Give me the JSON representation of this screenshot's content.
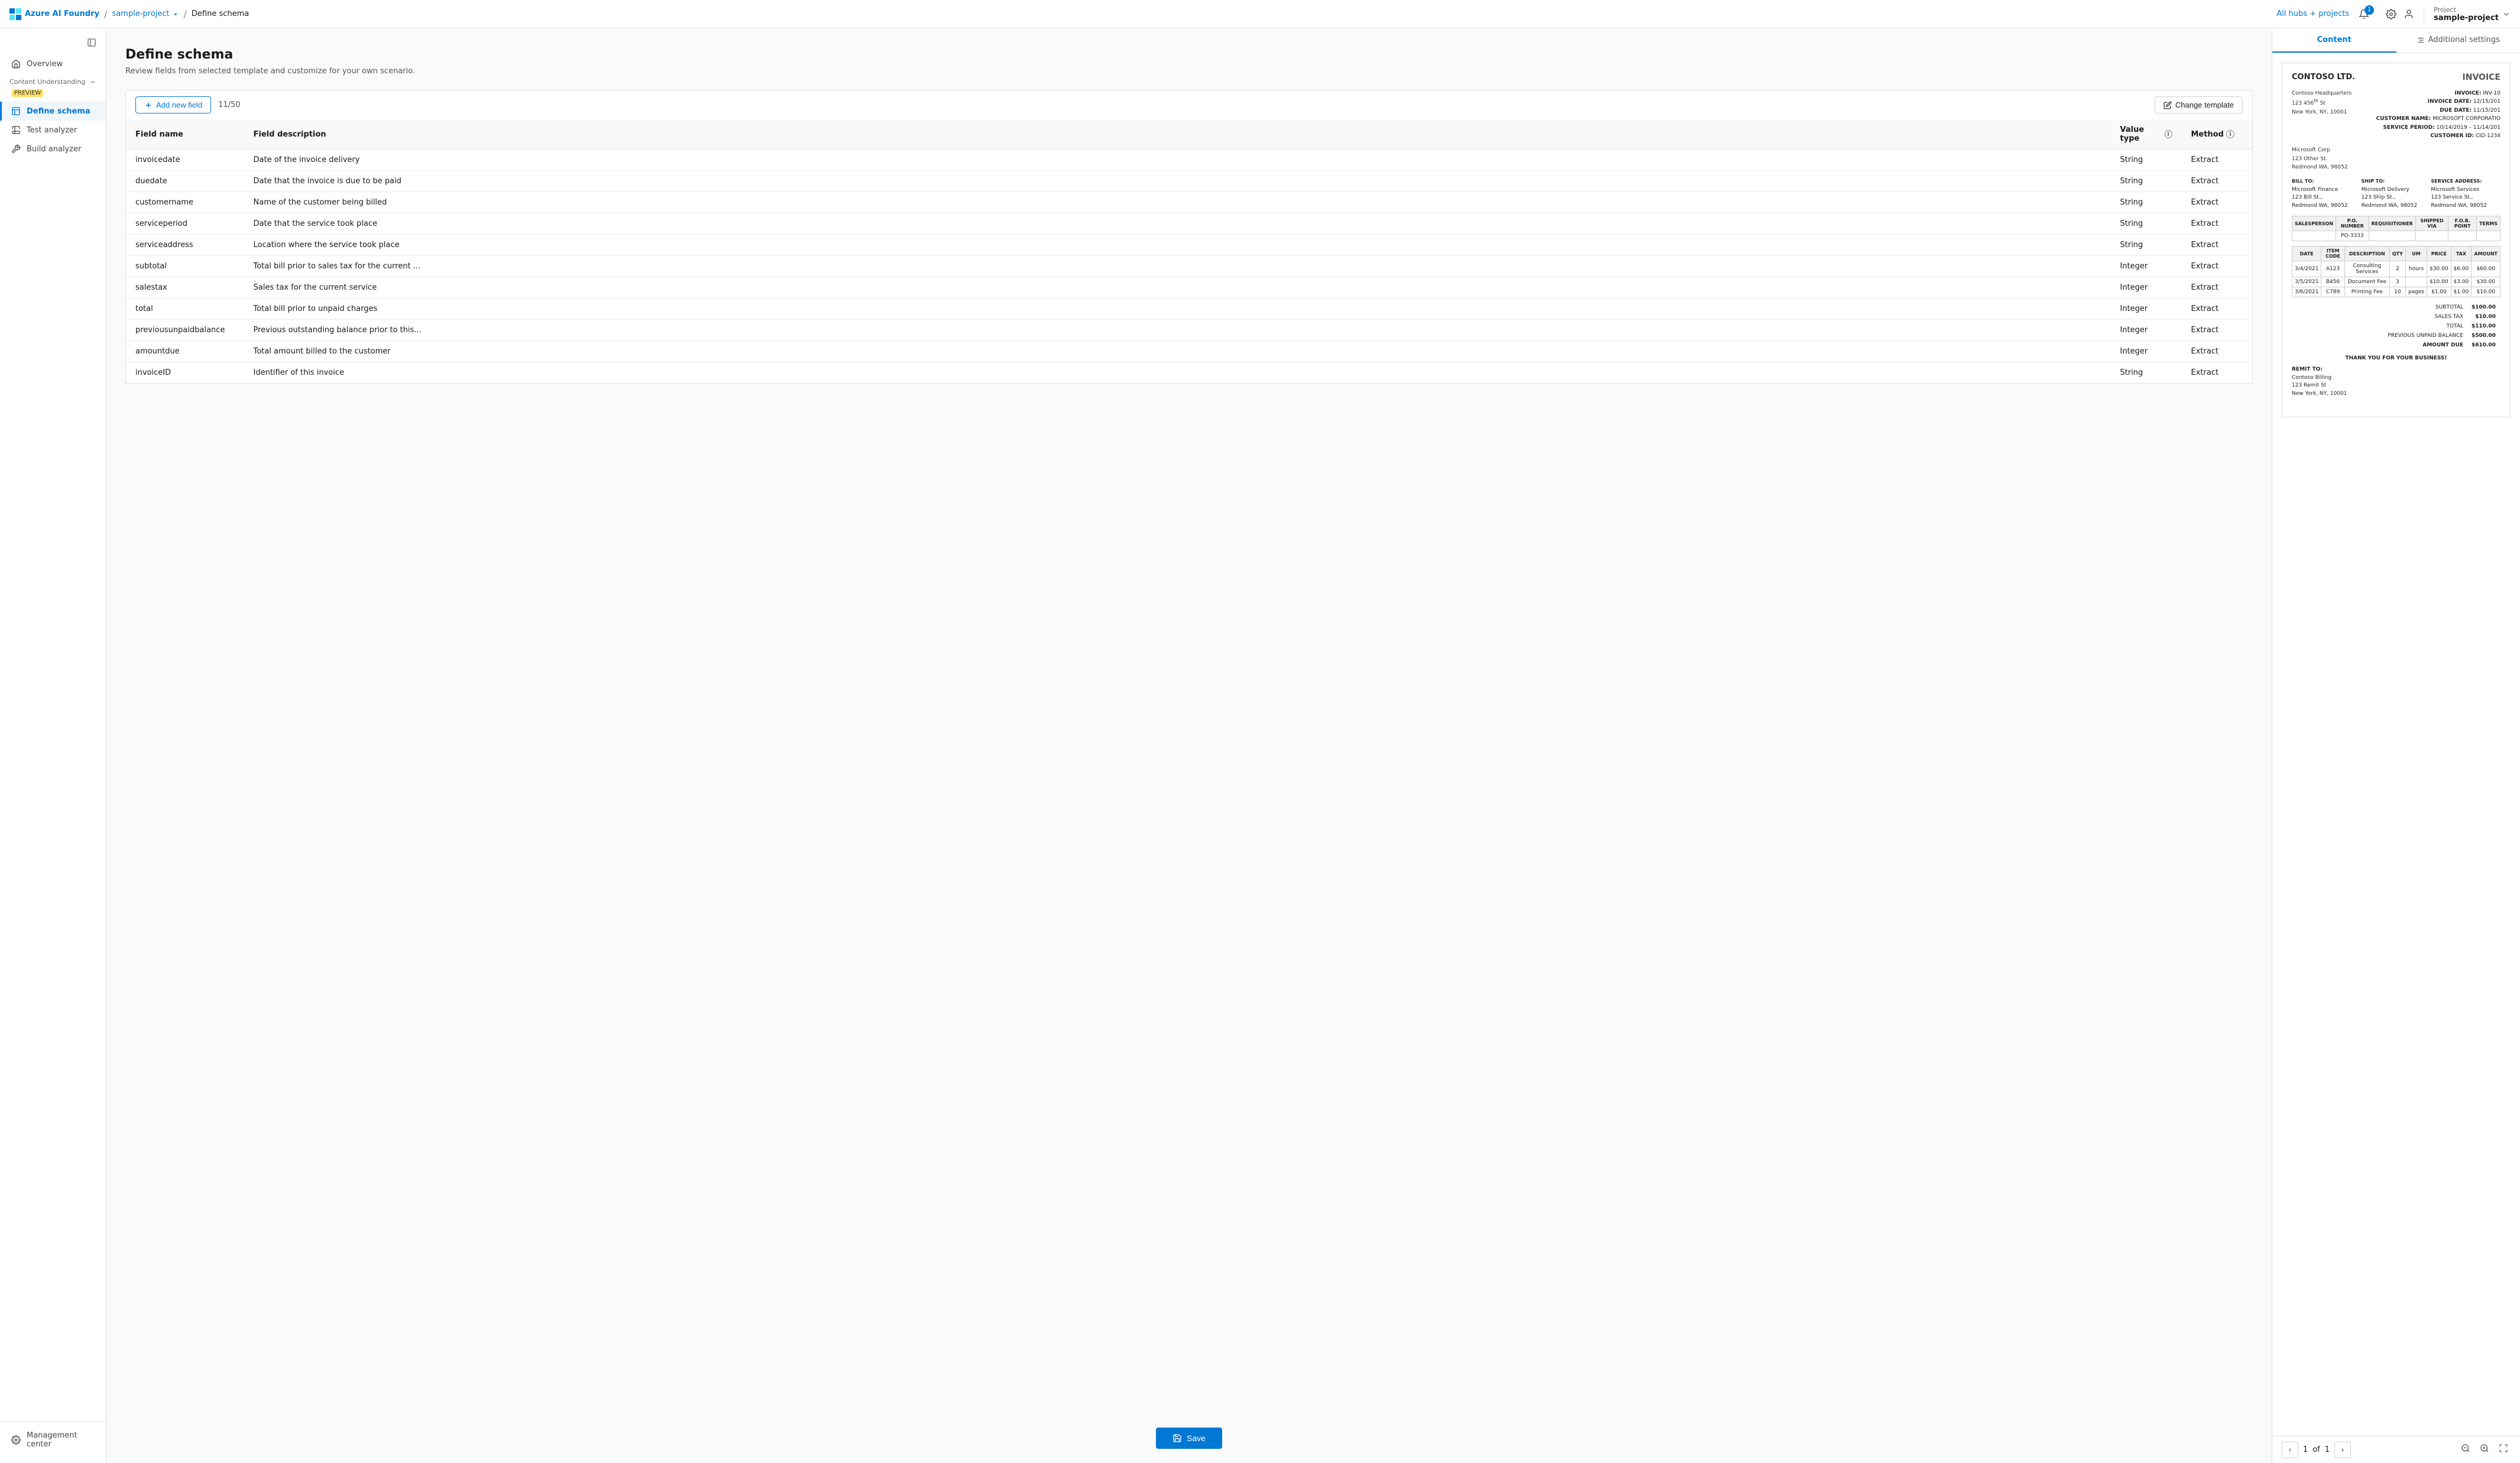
{
  "app": {
    "brand": "Azure AI Foundry",
    "project": "sample-project",
    "page": "Define schema",
    "hubs_link": "All hubs + projects",
    "project_label": "Project",
    "project_name": "sample-project"
  },
  "sidebar": {
    "toggle_title": "Collapse sidebar",
    "section_label": "Content Understanding",
    "section_badge": "PREVIEW",
    "items": [
      {
        "id": "overview",
        "label": "Overview",
        "icon": "home"
      },
      {
        "id": "define-schema",
        "label": "Define schema",
        "icon": "schema",
        "active": true
      },
      {
        "id": "test-analyzer",
        "label": "Test analyzer",
        "icon": "test"
      },
      {
        "id": "build-analyzer",
        "label": "Build analyzer",
        "icon": "build"
      }
    ],
    "bottom_item": {
      "id": "management",
      "label": "Management center",
      "icon": "settings"
    }
  },
  "schema": {
    "title": "Define schema",
    "subtitle": "Review fields from selected template and customize for your own scenario.",
    "toolbar": {
      "add_button": "Add new field",
      "field_count": "11/50",
      "change_template_button": "Change template"
    },
    "table": {
      "headers": [
        "Field name",
        "Field description",
        "Value type",
        "Method"
      ],
      "rows": [
        {
          "name": "invoicedate",
          "description": "Date of the invoice delivery",
          "type": "String",
          "method": "Extract"
        },
        {
          "name": "duedate",
          "description": "Date that the invoice is due to be paid",
          "type": "String",
          "method": "Extract"
        },
        {
          "name": "customername",
          "description": "Name of the customer being billed",
          "type": "String",
          "method": "Extract"
        },
        {
          "name": "serviceperiod",
          "description": "Date that the service took place",
          "type": "String",
          "method": "Extract"
        },
        {
          "name": "serviceaddress",
          "description": "Location where the service took place",
          "type": "String",
          "method": "Extract"
        },
        {
          "name": "subtotal",
          "description": "Total bill prior to sales tax for the current ...",
          "type": "Integer",
          "method": "Extract"
        },
        {
          "name": "salestax",
          "description": "Sales tax for the current service",
          "type": "Integer",
          "method": "Extract"
        },
        {
          "name": "total",
          "description": "Total bill prior to unpaid charges",
          "type": "Integer",
          "method": "Extract"
        },
        {
          "name": "previousunpaidbalance",
          "description": "Previous outstanding balance prior to this...",
          "type": "Integer",
          "method": "Extract"
        },
        {
          "name": "amountdue",
          "description": "Total amount billed to the customer",
          "type": "Integer",
          "method": "Extract"
        },
        {
          "name": "invoiceID",
          "description": "Identifier of this invoice",
          "type": "String",
          "method": "Extract"
        }
      ]
    },
    "save_button": "Save"
  },
  "right_panel": {
    "tabs": [
      {
        "id": "content",
        "label": "Content",
        "active": true
      },
      {
        "id": "additional-settings",
        "label": "Additional settings"
      }
    ],
    "invoice": {
      "company": "CONTOSO LTD.",
      "invoice_title": "INVOICE",
      "address_block": "Contoso Headquarters\n123 456th St\nNew York, NY, 10001",
      "meta_lines": [
        "INVOICE: INV-10",
        "INVOICE DATE: 12/15/201",
        "DUE DATE: 11/15/201",
        "CUSTOMER NAME: MICROSOFT CORPORATIO",
        "SERVICE PERIOD: 10/14/2019 - 11/14/201",
        "CUSTOMER ID: CID-1234"
      ],
      "ship_from": "Microsoft Corp\n123 Other St.\nRedmond WA, 98052",
      "bill_to_label": "BILL TO:",
      "bill_to": "Microsoft Finance\n123 Bill St.,\nRedmond WA, 98052",
      "ship_to_label": "SHIP TO:",
      "ship_to": "Microsoft Delivery\n123 Ship St.,\nRedmond WA, 98052",
      "service_address_label": "SERVICE ADDRESS:",
      "service_address": "Microsoft Services\n123 Service St.,\nRedmond WA, 98052",
      "order_headers": [
        "SALESPERSON",
        "P.O. NUMBER",
        "REQUISITIONER",
        "SHIPPED VIA",
        "F.O.B. POINT",
        "TERMS"
      ],
      "order_row": [
        "",
        "PO-3333",
        "",
        "",
        "",
        ""
      ],
      "line_headers": [
        "DATE",
        "ITEM CODE",
        "DESCRIPTION",
        "QTY",
        "UM",
        "PRICE",
        "TAX",
        "AMOUNT"
      ],
      "line_items": [
        {
          "date": "3/4/2021",
          "code": "A123",
          "desc": "Consulting Services",
          "qty": "2",
          "um": "hours",
          "price": "$30.00",
          "tax": "$6.00",
          "amount": "$60.00"
        },
        {
          "date": "3/5/2021",
          "code": "B456",
          "desc": "Document Fee",
          "qty": "3",
          "um": "",
          "price": "$10.00",
          "tax": "$3.00",
          "amount": "$30.00"
        },
        {
          "date": "3/6/2021",
          "code": "C789",
          "desc": "Printing Fee",
          "qty": "10",
          "um": "pages",
          "price": "$1.00",
          "tax": "$1.00",
          "amount": "$10.00"
        }
      ],
      "subtotal_label": "SUBTOTAL",
      "subtotal_value": "$100.00",
      "salestax_label": "SALES TAX",
      "salestax_value": "$10.00",
      "total_label": "TOTAL",
      "total_value": "$110.00",
      "prev_label": "PREVIOUS UNPAID BALANCE",
      "prev_value": "$500.00",
      "amount_label": "AMOUNT DUE",
      "amount_value": "$610.00",
      "thank_you": "THANK YOU FOR YOUR BUSINESS!",
      "remit_label": "REMIT TO:",
      "remit": "Contoso Billing\n123 Remit St\nNew York, NY, 10001"
    },
    "pagination": {
      "current": "1",
      "total": "1",
      "of_label": "of"
    }
  }
}
